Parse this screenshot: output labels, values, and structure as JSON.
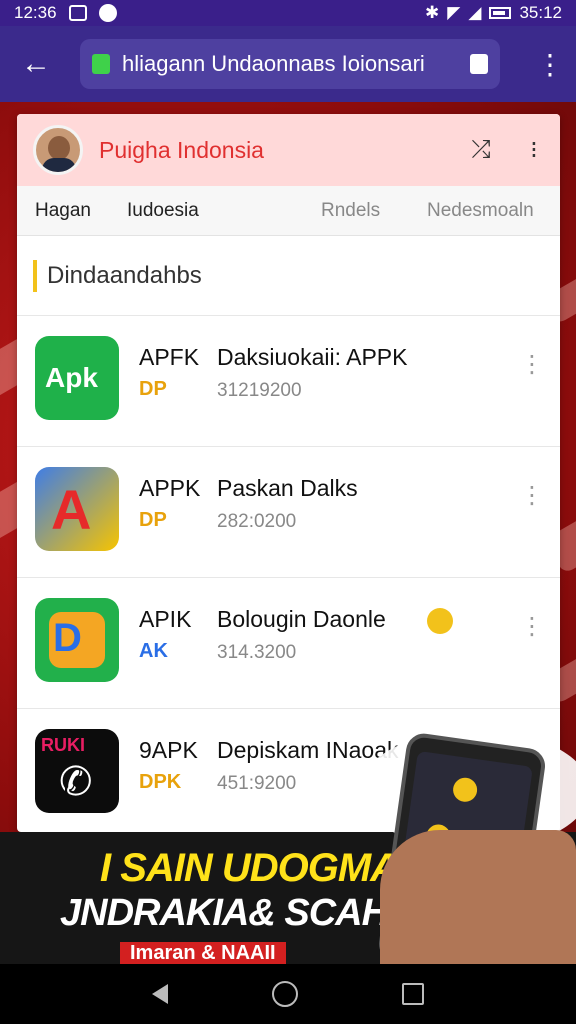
{
  "status_bar": {
    "time": "12:36",
    "right_time": "35:12"
  },
  "browser": {
    "url": "hliagann Undaonnaвs Ioionsari"
  },
  "card": {
    "header_title": "Puigha Indonsia",
    "tabs": [
      "Hagan",
      "Iudoesia",
      "Rndels",
      "Nedesmoaln"
    ],
    "section_title": "Dindaandahbs",
    "apps": [
      {
        "name": "APFK",
        "sub": "DP",
        "title": "Daksiuokaii: APPK",
        "size": "31219200",
        "icon": "apk-green-icon"
      },
      {
        "name": "APPK",
        "sub": "DP",
        "title": "Paskan Dalks",
        "size": "282:0200",
        "icon": "a-logo-icon"
      },
      {
        "name": "APIK",
        "sub": "AK",
        "title": "Bolougin Daonle",
        "size": "314.3200",
        "icon": "d-logo-icon"
      },
      {
        "name": "9APK",
        "sub": "DPK",
        "title": "Depiskam INaoak",
        "size": "451:9200",
        "icon": "phone-call-icon"
      }
    ]
  },
  "banner": {
    "line1": "I SAIN UDOGMAT",
    "line2": "JNDRAKIA& SCAHK",
    "line3": "Imaran & NAAII"
  },
  "colors": {
    "status_bar": "#3a1f8a",
    "browser_bar": "#3b2a8c",
    "header_bg": "#ffd9d9",
    "accent_red": "#e03030",
    "gold": "#f2c21b"
  }
}
